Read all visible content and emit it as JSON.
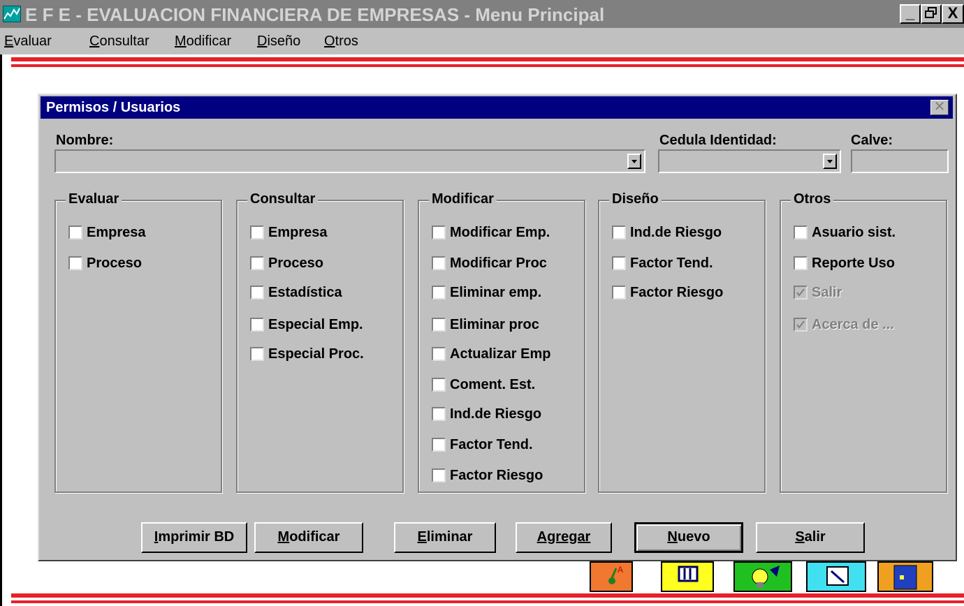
{
  "app": {
    "title": "E F E - EVALUACION FINANCIERA DE EMPRESAS - Menu Principal",
    "window_buttons": [
      "_",
      "🗗",
      "X"
    ]
  },
  "menu": {
    "items": [
      {
        "accel": "E",
        "rest": "valuar"
      },
      {
        "accel": "C",
        "rest": "onsultar"
      },
      {
        "accel": "M",
        "rest": "odificar"
      },
      {
        "accel": "D",
        "rest": "iseño"
      },
      {
        "accel": "O",
        "rest": "tros"
      }
    ]
  },
  "dialog": {
    "title": "Permisos / Usuarios",
    "close": "✕",
    "nombre_label": "Nombre:",
    "cedula_label": "Cedula Identidad:",
    "clave_label": "Calve:",
    "nombre_value": "",
    "cedula_value": "",
    "clave_value": ""
  },
  "groups": [
    {
      "title": "Evaluar",
      "items": [
        {
          "label": "Empresa",
          "checked": false,
          "disabled": false
        },
        {
          "label": "Proceso",
          "checked": false,
          "disabled": false
        }
      ]
    },
    {
      "title": "Consultar",
      "items": [
        {
          "label": "Empresa",
          "checked": false,
          "disabled": false
        },
        {
          "label": "Proceso",
          "checked": false,
          "disabled": false
        },
        {
          "label": "Estadística",
          "checked": false,
          "disabled": false
        },
        {
          "label": "Especial Emp.",
          "checked": false,
          "disabled": false
        },
        {
          "label": "Especial Proc.",
          "checked": false,
          "disabled": false
        }
      ]
    },
    {
      "title": "Modificar",
      "items": [
        {
          "label": "Modificar Emp.",
          "checked": false,
          "disabled": false
        },
        {
          "label": "Modificar Proc",
          "checked": false,
          "disabled": false
        },
        {
          "label": "Eliminar emp.",
          "checked": false,
          "disabled": false
        },
        {
          "label": "Eliminar proc",
          "checked": false,
          "disabled": false
        },
        {
          "label": "Actualizar Emp",
          "checked": false,
          "disabled": false
        },
        {
          "label": "Coment. Est.",
          "checked": false,
          "disabled": false
        },
        {
          "label": "Ind.de Riesgo",
          "checked": false,
          "disabled": false
        },
        {
          "label": "Factor Tend.",
          "checked": false,
          "disabled": false
        },
        {
          "label": "Factor Riesgo",
          "checked": false,
          "disabled": false
        }
      ]
    },
    {
      "title": "Diseño",
      "items": [
        {
          "label": "Ind.de Riesgo",
          "checked": false,
          "disabled": false
        },
        {
          "label": "Factor Tend.",
          "checked": false,
          "disabled": false
        },
        {
          "label": "Factor Riesgo",
          "checked": false,
          "disabled": false
        }
      ]
    },
    {
      "title": "Otros",
      "items": [
        {
          "label": "Asuario sist.",
          "checked": false,
          "disabled": false
        },
        {
          "label": "Reporte Uso",
          "checked": false,
          "disabled": false
        },
        {
          "label": "Salir",
          "checked": true,
          "disabled": true
        },
        {
          "label": "Acerca de ...",
          "checked": true,
          "disabled": true
        }
      ]
    }
  ],
  "buttons": [
    {
      "accel": "I",
      "rest": "mprimir BD"
    },
    {
      "accel": "M",
      "rest": "odificar"
    },
    {
      "accel": "E",
      "rest": "liminar"
    },
    {
      "accel": "",
      "rest": "Agregar"
    },
    {
      "accel": "N",
      "rest": "uevo"
    },
    {
      "accel": "S",
      "rest": "alir"
    }
  ],
  "toolbar_icons": [
    "evaluate-icon",
    "columns-icon",
    "lightbulb-icon",
    "magnify-icon",
    "book-icon"
  ],
  "colors": {
    "titlebar_inactive": "#808080",
    "dialog_titlebar": "#000080",
    "stripe": "#e8202a",
    "face": "#c0c0c0"
  }
}
